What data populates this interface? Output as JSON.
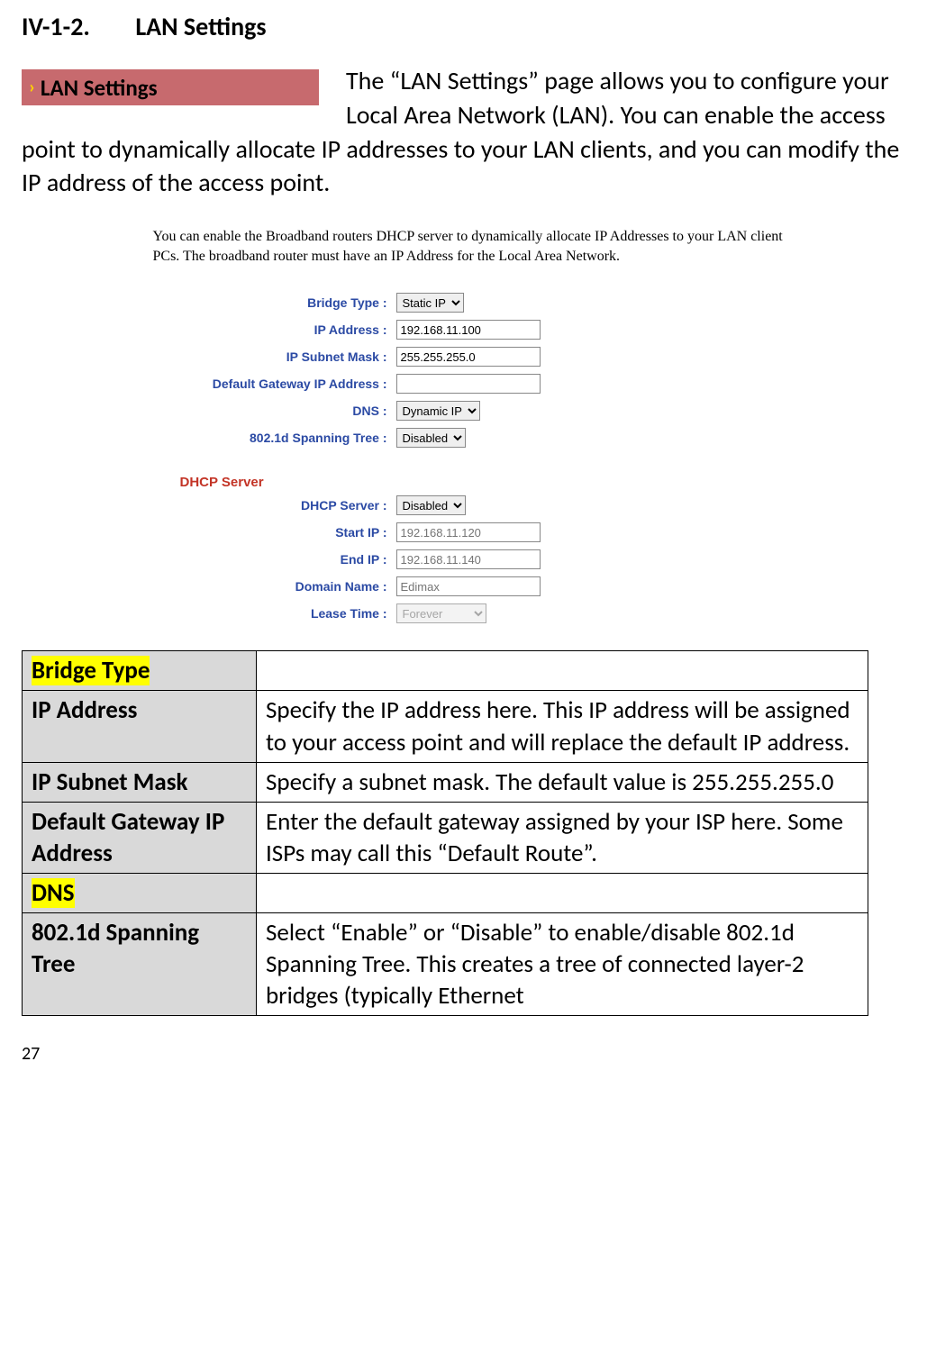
{
  "heading": {
    "number": "IV-1-2.",
    "title": "LAN Settings"
  },
  "badge": "LAN Settings",
  "intro": "The “LAN Settings” page allows you to configure your Local Area Network (LAN). You can enable the access point to dynamically allocate IP addresses to your LAN clients, and you can modify the IP address of the access point.",
  "panel": {
    "desc": "You can enable the Broadband routers DHCP server to dynamically allocate IP Addresses to your LAN client PCs. The broadband router must have an IP Address for the Local Area Network.",
    "fields": {
      "bridge_type": {
        "label": "Bridge Type :",
        "value": "Static IP"
      },
      "ip_address": {
        "label": "IP Address :",
        "value": "192.168.11.100"
      },
      "subnet_mask": {
        "label": "IP Subnet Mask :",
        "value": "255.255.255.0"
      },
      "gateway": {
        "label": "Default Gateway IP Address :",
        "value": ""
      },
      "dns": {
        "label": "DNS :",
        "value": "Dynamic IP"
      },
      "spanning": {
        "label": "802.1d Spanning Tree :",
        "value": "Disabled"
      }
    },
    "dhcp_header": "DHCP Server",
    "dhcp": {
      "server": {
        "label": "DHCP Server :",
        "value": "Disabled"
      },
      "start_ip": {
        "label": "Start IP :",
        "placeholder": "192.168.11.120"
      },
      "end_ip": {
        "label": "End IP :",
        "placeholder": "192.168.11.140"
      },
      "domain": {
        "label": "Domain Name :",
        "placeholder": "Edimax"
      },
      "lease": {
        "label": "Lease Time :",
        "value": "Forever"
      }
    }
  },
  "defs": [
    {
      "term": "Bridge Type",
      "hl": true,
      "desc": ""
    },
    {
      "term": "IP Address",
      "hl": false,
      "desc": "Specify the IP address here. This IP address will be assigned to your access point and will replace the default IP address."
    },
    {
      "term": "IP Subnet Mask",
      "hl": false,
      "desc": "Specify a subnet mask. The default value is 255.255.255.0"
    },
    {
      "term": "Default Gateway IP Address",
      "hl": false,
      "desc": "Enter the default gateway assigned by your ISP here. Some ISPs may call this “Default Route”."
    },
    {
      "term": "DNS",
      "hl": true,
      "desc": ""
    },
    {
      "term": "802.1d Spanning Tree",
      "hl": false,
      "desc": "Select “Enable” or “Disable” to enable/disable 802.1d Spanning Tree. This creates a tree of connected layer-2 bridges (typically Ethernet"
    }
  ],
  "page_number": "27"
}
